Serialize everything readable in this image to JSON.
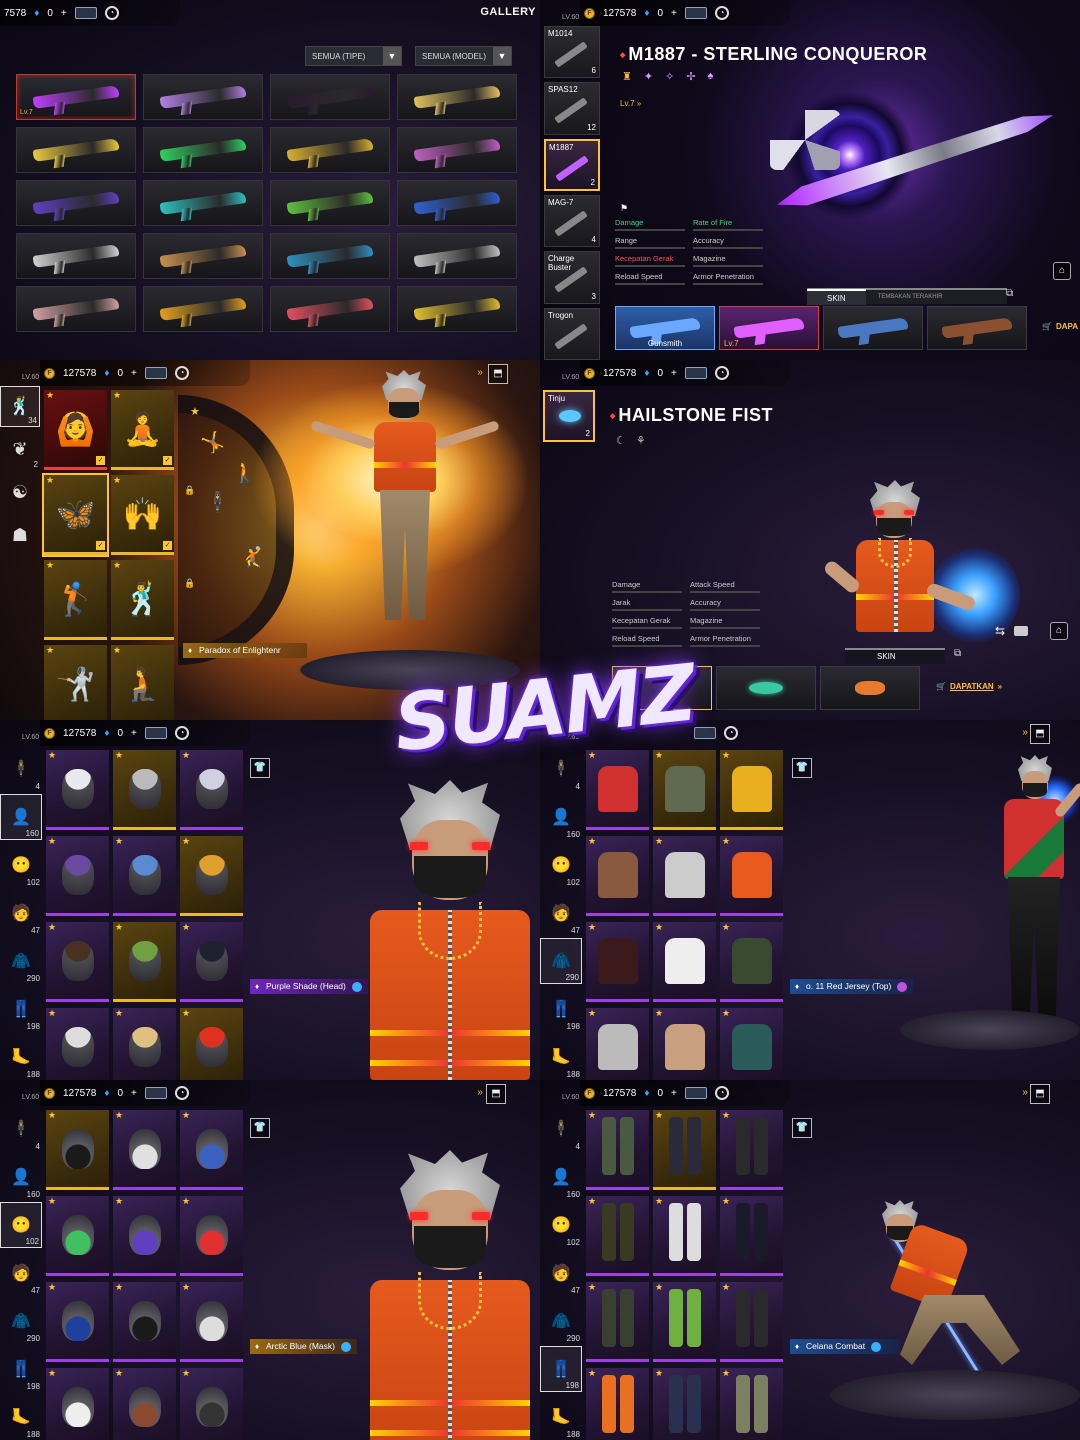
{
  "currency": {
    "coins": "127578",
    "coins_cut": "7578",
    "diamonds": "0",
    "plus": "+",
    "level": "LV.60"
  },
  "p1": {
    "title": "GALLERY",
    "filter_type": "SEMUA (TIPE)",
    "filter_model": "SEMUA (MODEL)",
    "badge": "Lv.7",
    "colors": [
      "#c040ff",
      "#b080e0",
      "#2a1a30",
      "#e0c060",
      "#e8c840",
      "#30d060",
      "#d8b030",
      "#c060c0",
      "#6040c0",
      "#30c0c0",
      "#60c040",
      "#3060d0",
      "#d0d0d0",
      "#c89050",
      "#3090c0",
      "#c0c0c0",
      "#d0a0a0",
      "#e0a020",
      "#e05060",
      "#e0c030"
    ]
  },
  "p2": {
    "weapons": [
      {
        "name": "M1014",
        "count": "6"
      },
      {
        "name": "SPAS12",
        "count": "12"
      },
      {
        "name": "M1887",
        "count": "2"
      },
      {
        "name": "MAG-7",
        "count": "4"
      },
      {
        "name": "Charge Buster",
        "count": "3"
      },
      {
        "name": "Trogon",
        "count": ""
      }
    ],
    "title": "M1887 - STERLING CONQUEROR",
    "lv": "Lv.7",
    "stats": [
      "Damage",
      "Rate of Fire",
      "Range",
      "Accuracy",
      "Kecepatan Gerak",
      "Magazine",
      "Reload Speed",
      "Armor Penetration"
    ],
    "tab_skin": "SKIN",
    "tab_recent": "TEMBAKAN TERAKHIR",
    "gunsmith": "Gunsmith",
    "get": "DAPA"
  },
  "p3": {
    "cat_counts": [
      "34",
      "2"
    ],
    "tag": "Paradox of Enlightenr"
  },
  "p4": {
    "item": "Tinju",
    "item_count": "2",
    "title": "HAILSTONE FIST",
    "stats": [
      "Damage",
      "Attack Speed",
      "Jarak",
      "Accuracy",
      "Kecepatan Gerak",
      "Magazine",
      "Reload Speed",
      "Armor Penetration"
    ],
    "skin": "SKIN",
    "get": "DAPATKAN"
  },
  "cats": [
    "4",
    "160",
    "102",
    "47",
    "290",
    "198",
    "188"
  ],
  "p5": {
    "tag": "Purple Shade (Head)"
  },
  "p6": {
    "tag": "o. 11 Red Jersey (Top)"
  },
  "p7": {
    "tag": "Arctic Blue (Mask)"
  },
  "p8": {
    "tag": "Celana Combat"
  },
  "logo": "SUAMZ"
}
